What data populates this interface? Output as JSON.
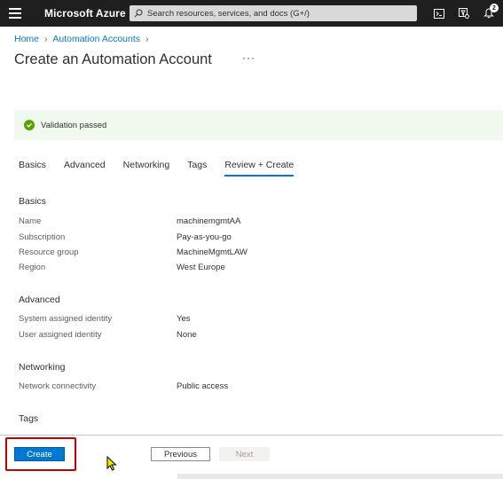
{
  "topbar": {
    "brand": "Microsoft Azure",
    "search_placeholder": "Search resources, services, and docs (G+/)",
    "notification_count": "2"
  },
  "breadcrumb": {
    "home": "Home",
    "automation_accounts": "Automation Accounts"
  },
  "page": {
    "title": "Create an Automation Account",
    "more": "···"
  },
  "validation": {
    "text": "Validation passed",
    "color": "#57a300"
  },
  "tabs": [
    {
      "label": "Basics"
    },
    {
      "label": "Advanced"
    },
    {
      "label": "Networking"
    },
    {
      "label": "Tags"
    },
    {
      "label": "Review + Create"
    }
  ],
  "review": {
    "basics": {
      "title": "Basics",
      "name_label": "Name",
      "name_value": "machinemgmtAA",
      "subscription_label": "Subscription",
      "subscription_value": "Pay-as-you-go",
      "resource_group_label": "Resource group",
      "resource_group_value": "MachineMgmtLAW",
      "region_label": "Region",
      "region_value": "West Europe"
    },
    "advanced": {
      "title": "Advanced",
      "system_identity_label": "System assigned identity",
      "system_identity_value": "Yes",
      "user_identity_label": "User assigned identity",
      "user_identity_value": "None"
    },
    "networking": {
      "title": "Networking",
      "connectivity_label": "Network connectivity",
      "connectivity_value": "Public access"
    },
    "tags": {
      "title": "Tags"
    }
  },
  "footer": {
    "create": "Create",
    "previous": "Previous",
    "next": "Next"
  },
  "colors": {
    "accent": "#0078d4",
    "topbar": "#1f1f1f",
    "highlight": "#c40000"
  }
}
